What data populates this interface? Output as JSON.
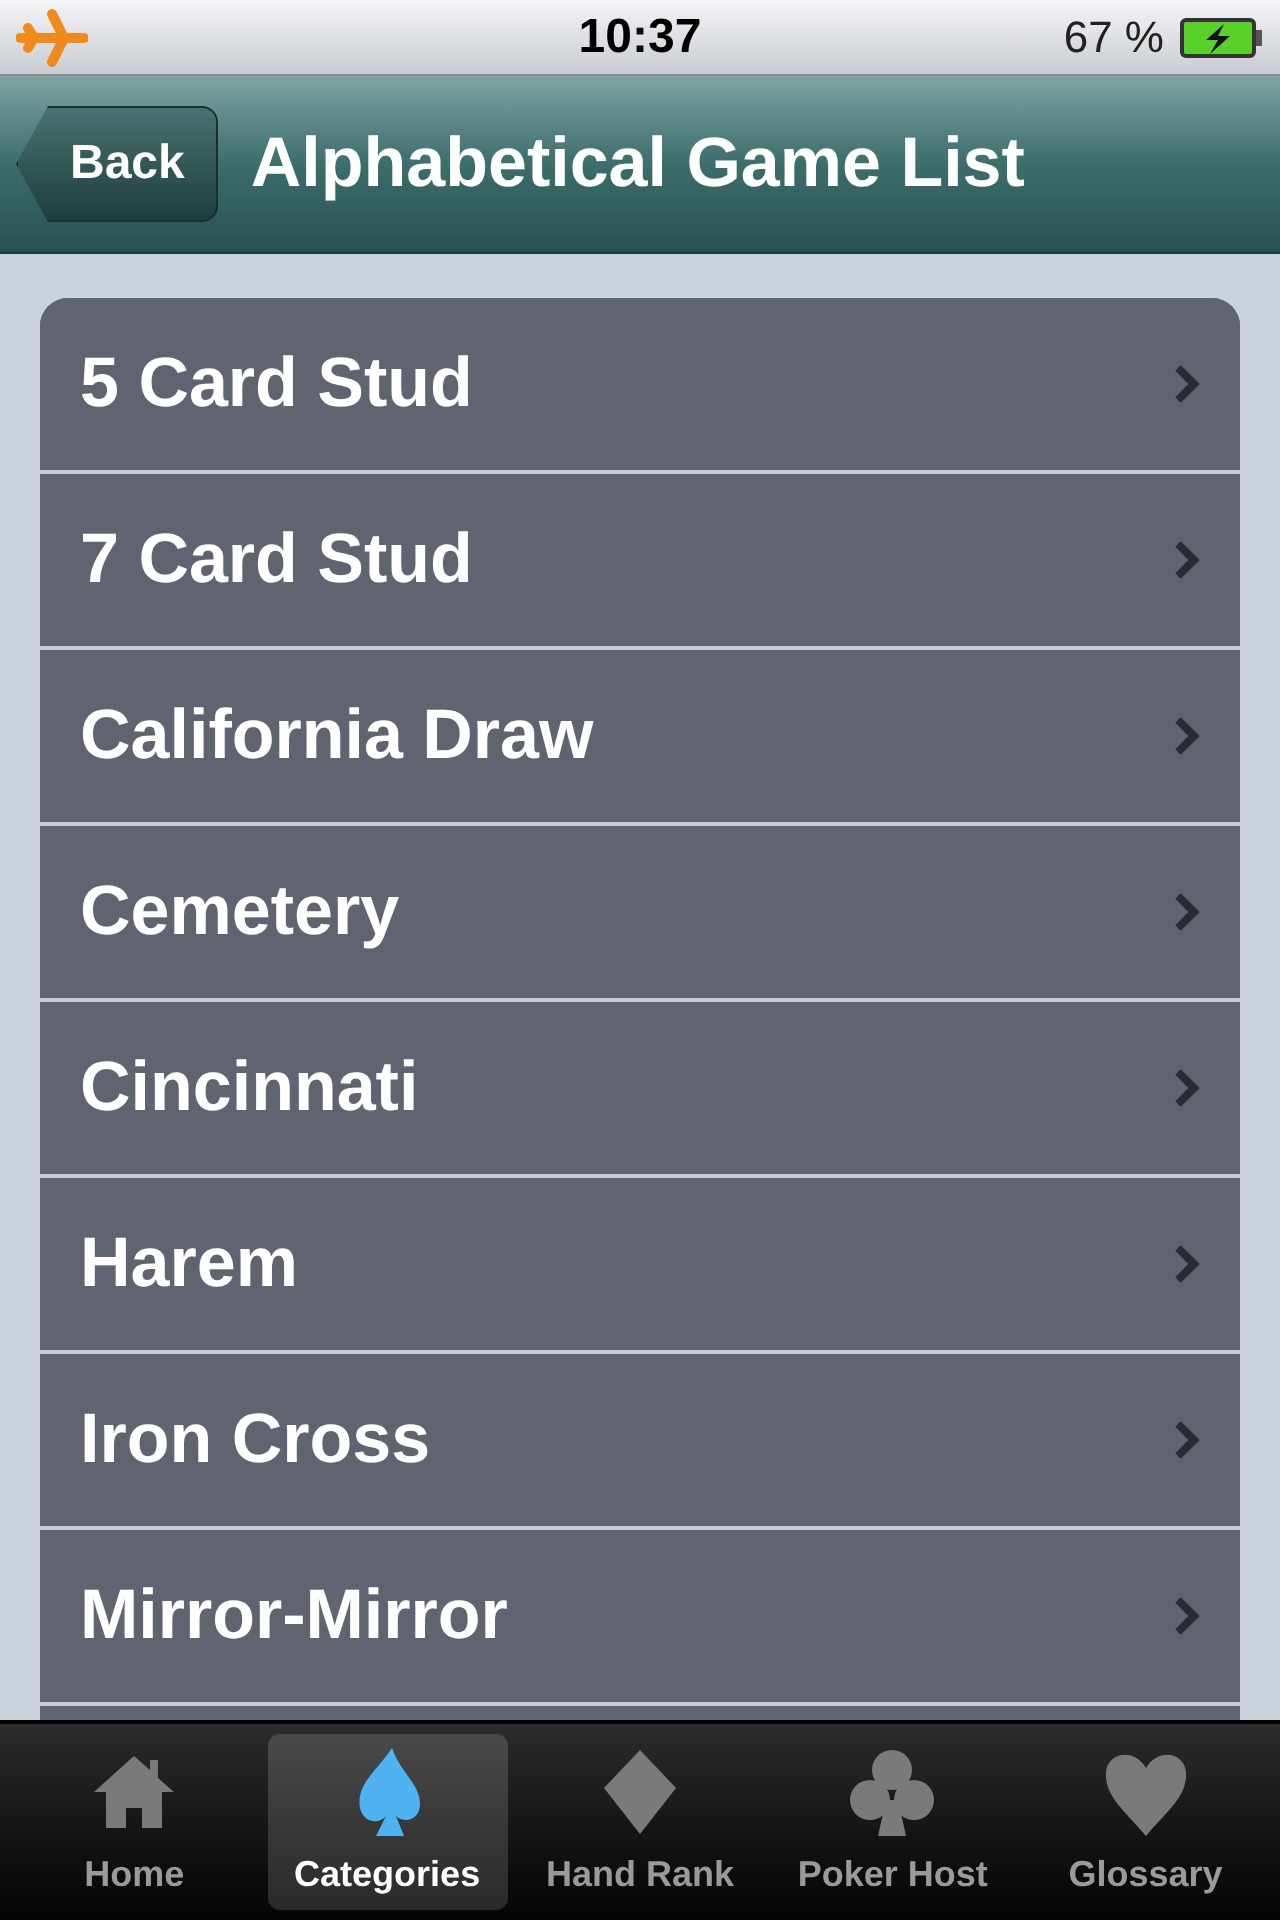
{
  "status_bar": {
    "time": "10:37",
    "battery": "67 %"
  },
  "nav_bar": {
    "back": "Back",
    "title": "Alphabetical Game List"
  },
  "list": [
    {
      "label": "5 Card Stud"
    },
    {
      "label": "7 Card Stud"
    },
    {
      "label": "California Draw"
    },
    {
      "label": "Cemetery"
    },
    {
      "label": "Cincinnati"
    },
    {
      "label": "Harem"
    },
    {
      "label": "Iron Cross"
    },
    {
      "label": "Mirror-Mirror"
    }
  ],
  "tab_bar": [
    {
      "label": "Home",
      "selected": false
    },
    {
      "label": "Categories",
      "selected": true
    },
    {
      "label": "Hand Rank",
      "selected": false
    },
    {
      "label": "Poker Host",
      "selected": false
    },
    {
      "label": "Glossary",
      "selected": false
    }
  ]
}
